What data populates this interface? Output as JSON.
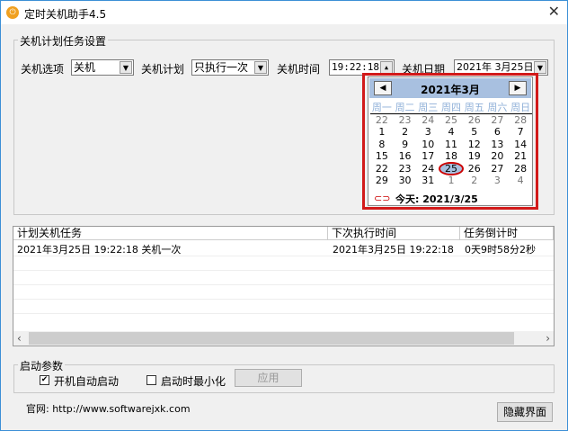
{
  "window": {
    "title": "定时关机助手4.5"
  },
  "settings": {
    "group_title": "关机计划任务设置",
    "option_label": "关机选项",
    "option_value": "关机",
    "plan_label": "关机计划",
    "plan_value": "只执行一次",
    "time_label": "关机时间",
    "time_value": "19:22:18",
    "date_label": "关机日期",
    "date_value": "2021年 3月25日"
  },
  "calendar": {
    "month_title": "2021年3月",
    "weekdays": [
      "周一",
      "周二",
      "周三",
      "周四",
      "周五",
      "周六",
      "周日"
    ],
    "days": [
      [
        "22",
        "23",
        "24",
        "25",
        "26",
        "27",
        "28"
      ],
      [
        "1",
        "2",
        "3",
        "4",
        "5",
        "6",
        "7"
      ],
      [
        "8",
        "9",
        "10",
        "11",
        "12",
        "13",
        "14"
      ],
      [
        "15",
        "16",
        "17",
        "18",
        "19",
        "20",
        "21"
      ],
      [
        "22",
        "23",
        "24",
        "25",
        "26",
        "27",
        "28"
      ],
      [
        "29",
        "30",
        "31",
        "1",
        "2",
        "3",
        "4"
      ]
    ],
    "selected": "25",
    "today_label": "今天: 2021/3/25"
  },
  "tasks": {
    "columns": [
      "计划关机任务",
      "下次执行时间",
      "任务倒计时"
    ],
    "rows": [
      [
        "2021年3月25日 19:22:18 关机一次",
        "2021年3月25日 19:22:18",
        "0天9时58分2秒"
      ]
    ]
  },
  "startup": {
    "group_title": "启动参数",
    "autostart_label": "开机自动启动",
    "autostart_checked": true,
    "minimize_label": "启动时最小化",
    "minimize_checked": false,
    "apply_label": "应用"
  },
  "footer": {
    "website": "官网: http://www.softwarejxk.com",
    "hide_label": "隐藏界面"
  },
  "accent": "#d21a1a"
}
